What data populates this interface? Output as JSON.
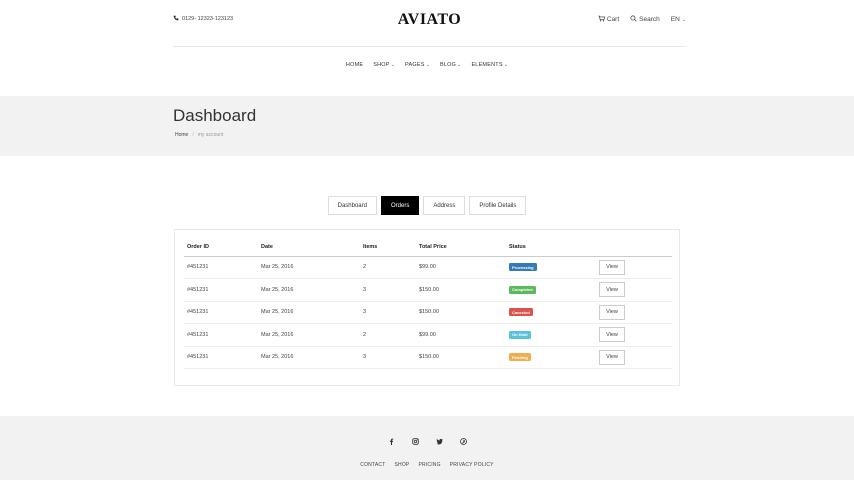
{
  "topbar": {
    "phone": "0129- 12323-123123",
    "logo": "AVIATO",
    "cart_label": "Cart",
    "search_label": "Search",
    "language": "EN"
  },
  "nav": {
    "items": [
      {
        "label": "HOME"
      },
      {
        "label": "SHOP"
      },
      {
        "label": "PAGES"
      },
      {
        "label": "BLOG"
      },
      {
        "label": "ELEMENTS"
      }
    ]
  },
  "page_header": {
    "title": "Dashboard",
    "breadcrumb": [
      "Home",
      "my account"
    ]
  },
  "tabs": [
    "Dashboard",
    "Orders",
    "Address",
    "Profile Details"
  ],
  "active_tab": "Orders",
  "orders": {
    "columns": [
      "Order ID",
      "Date",
      "Items",
      "Total Price",
      "Status",
      ""
    ],
    "rows": [
      {
        "id": "#451231",
        "date": "Mar 25, 2016",
        "items": "2",
        "total": "$99.00",
        "status": "Processing",
        "status_color": "#337ab7",
        "action": "View"
      },
      {
        "id": "#451231",
        "date": "Mar 25, 2016",
        "items": "3",
        "total": "$150.00",
        "status": "Completed",
        "status_color": "#5cb85c",
        "action": "View"
      },
      {
        "id": "#451231",
        "date": "Mar 25, 2016",
        "items": "3",
        "total": "$150.00",
        "status": "Canceled",
        "status_color": "#d9534f",
        "action": "View"
      },
      {
        "id": "#451231",
        "date": "Mar 25, 2016",
        "items": "2",
        "total": "$99.00",
        "status": "On Hold",
        "status_color": "#5bc0de",
        "action": "View"
      },
      {
        "id": "#451231",
        "date": "Mar 25, 2016",
        "items": "3",
        "total": "$150.00",
        "status": "Pending",
        "status_color": "#f0ad4e",
        "action": "View"
      }
    ]
  },
  "footer": {
    "social": [
      "facebook-icon",
      "instagram-icon",
      "twitter-icon",
      "pinterest-icon"
    ],
    "links": [
      "CONTACT",
      "SHOP",
      "PRICING",
      "PRIVACY POLICY"
    ]
  }
}
